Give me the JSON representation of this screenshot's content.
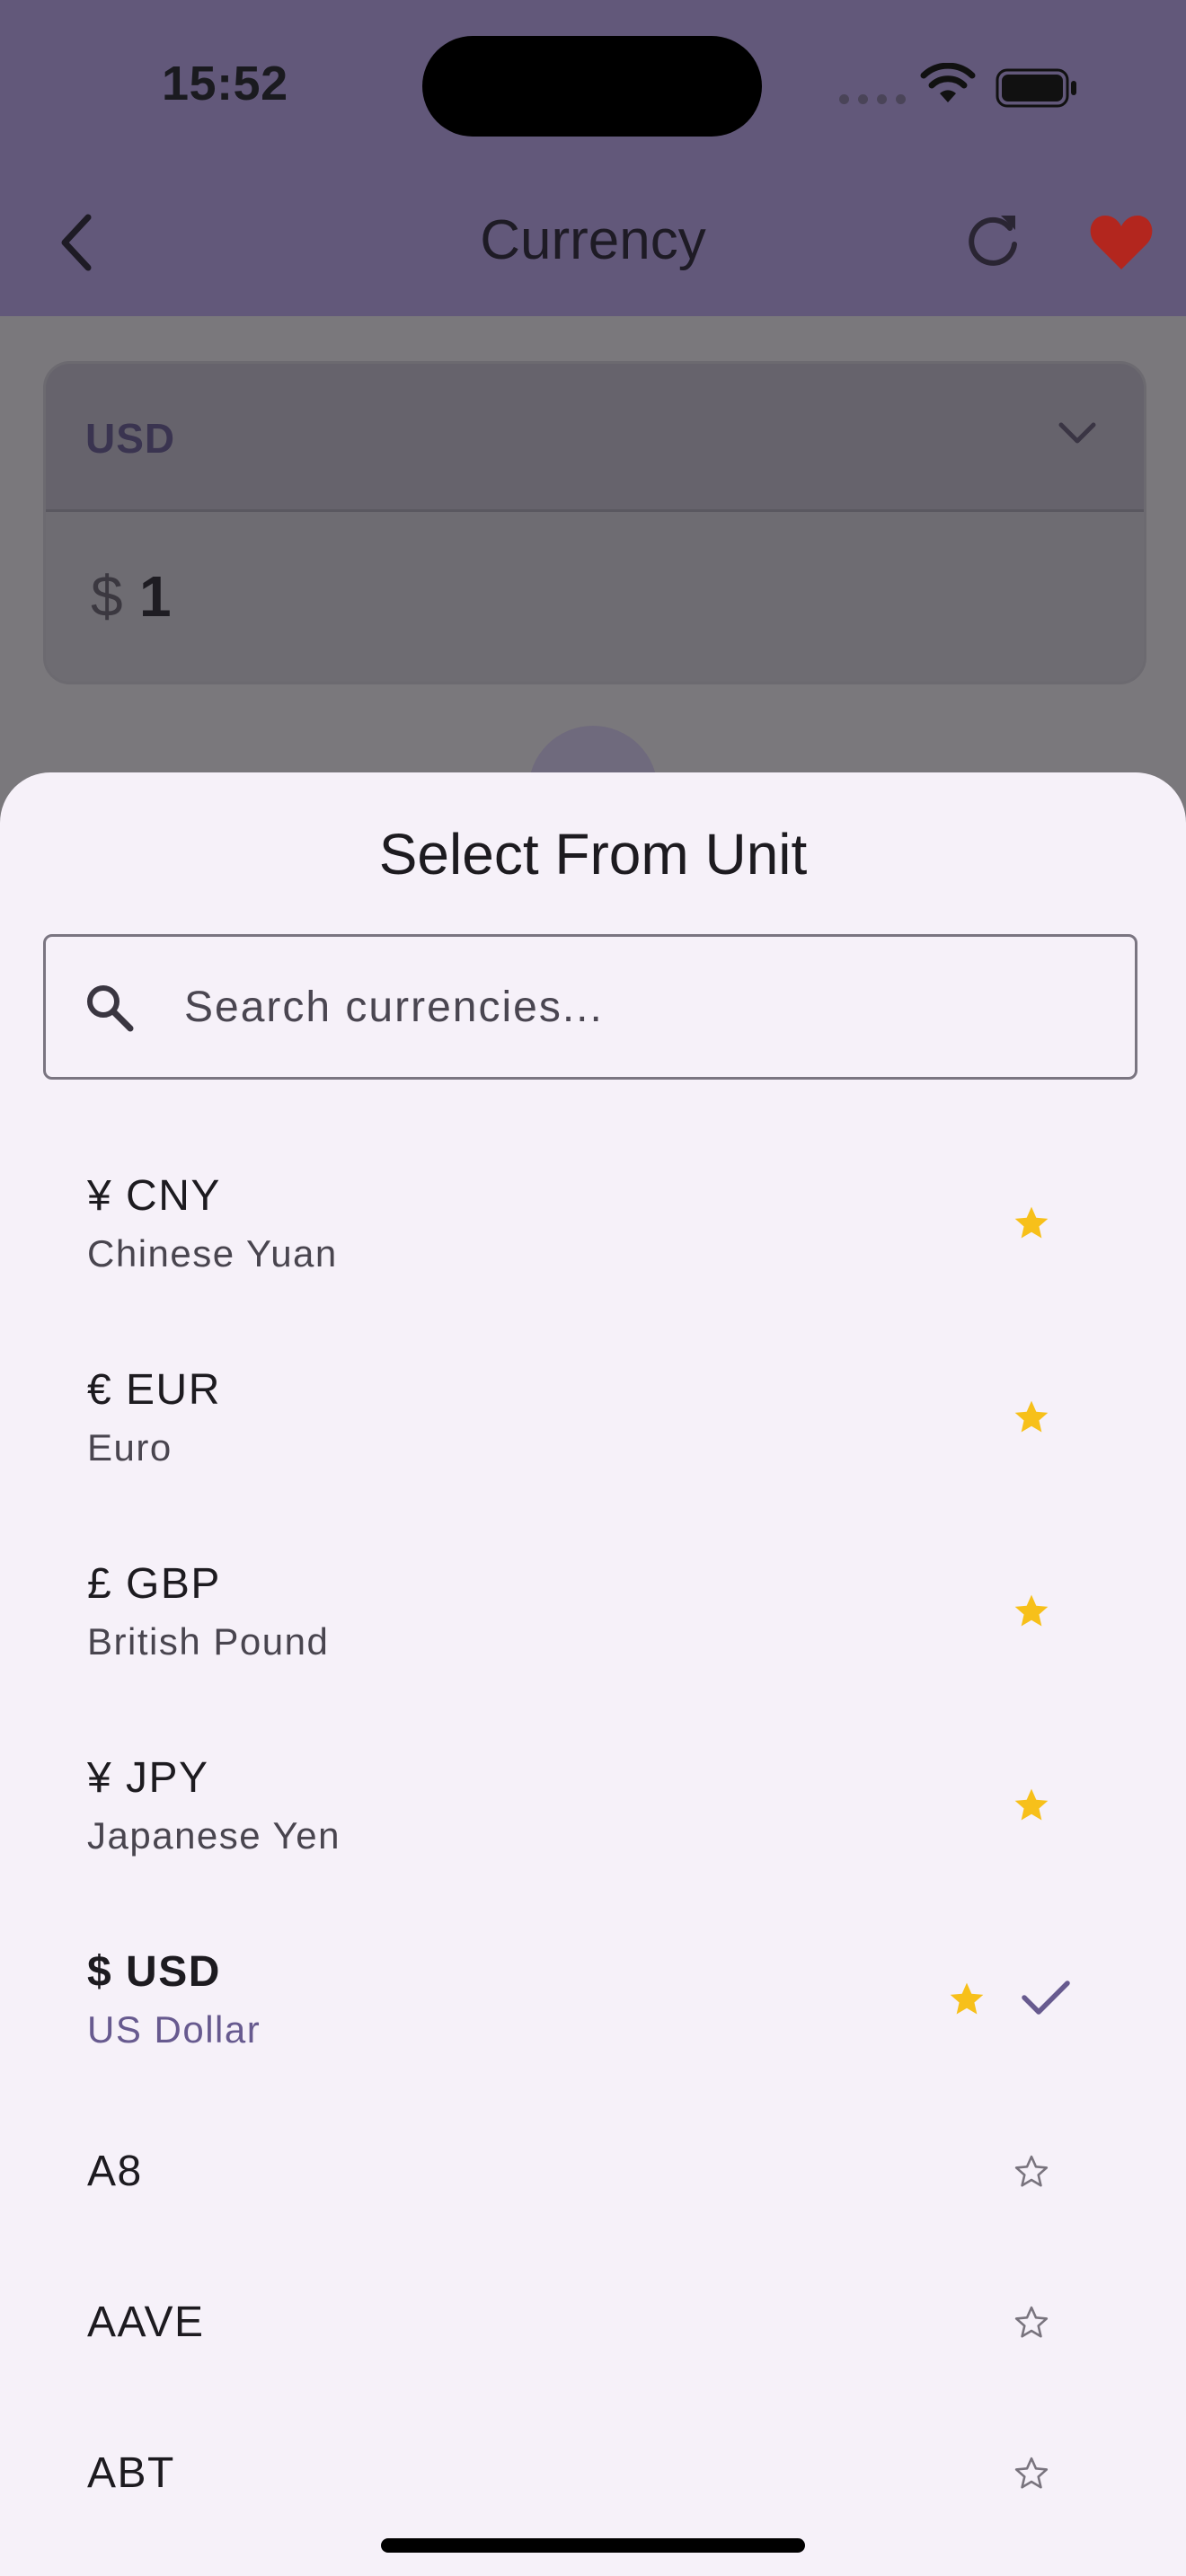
{
  "status_bar": {
    "time": "15:52"
  },
  "header": {
    "title": "Currency"
  },
  "converter": {
    "from_unit": "USD",
    "amount_symbol": "$",
    "amount_value": "1"
  },
  "sheet": {
    "title": "Select From Unit",
    "search_placeholder": "Search currencies...",
    "items": [
      {
        "code": "¥ CNY",
        "name": "Chinese Yuan",
        "favorite": true,
        "selected": false
      },
      {
        "code": "€ EUR",
        "name": "Euro",
        "favorite": true,
        "selected": false
      },
      {
        "code": "£ GBP",
        "name": "British Pound",
        "favorite": true,
        "selected": false
      },
      {
        "code": "¥ JPY",
        "name": "Japanese Yen",
        "favorite": true,
        "selected": false
      },
      {
        "code": "$ USD",
        "name": "US Dollar",
        "favorite": true,
        "selected": true
      },
      {
        "code": "A8",
        "favorite": false,
        "selected": false
      },
      {
        "code": "AAVE",
        "favorite": false,
        "selected": false
      },
      {
        "code": "ABT",
        "favorite": false,
        "selected": false
      }
    ]
  },
  "colors": {
    "appbar": "#62587a",
    "star_filled": "#f7c01a",
    "heart": "#b3261e",
    "accent": "#675a8f"
  }
}
